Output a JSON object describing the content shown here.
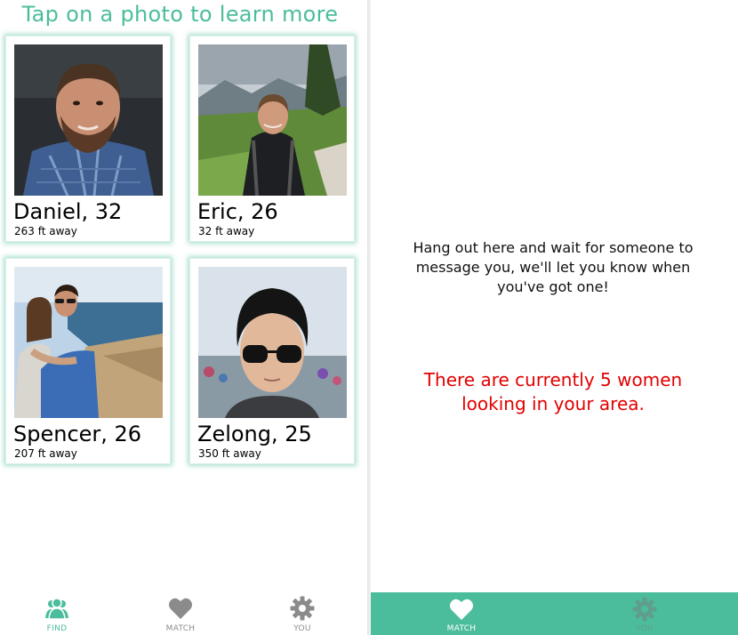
{
  "find_screen": {
    "heading": "Tap on a photo to learn more",
    "profiles": [
      {
        "name": "Daniel, 32",
        "distance": "263 ft away"
      },
      {
        "name": "Eric, 26",
        "distance": "32 ft away"
      },
      {
        "name": "Spencer, 26",
        "distance": "207 ft away"
      },
      {
        "name": "Zelong, 25",
        "distance": "350 ft away"
      }
    ],
    "tabs": [
      {
        "label": "FIND",
        "icon": "people-icon",
        "active": true
      },
      {
        "label": "MATCH",
        "icon": "heart-icon",
        "active": false
      },
      {
        "label": "YOU",
        "icon": "gear-icon",
        "active": false
      }
    ]
  },
  "match_screen": {
    "wait_message": "Hang out here and wait for someone to message you, we'll let you know when you've got one!",
    "count_message": "There are currently 5 women looking in your area.",
    "tabs": [
      {
        "label": "MATCH",
        "icon": "heart-icon",
        "active": true
      },
      {
        "label": "YOU",
        "icon": "gear-icon",
        "active": false
      }
    ]
  },
  "colors": {
    "accent": "#4cbd9c",
    "alert": "#e30000",
    "inactive_icon": "#8b8b8b"
  }
}
